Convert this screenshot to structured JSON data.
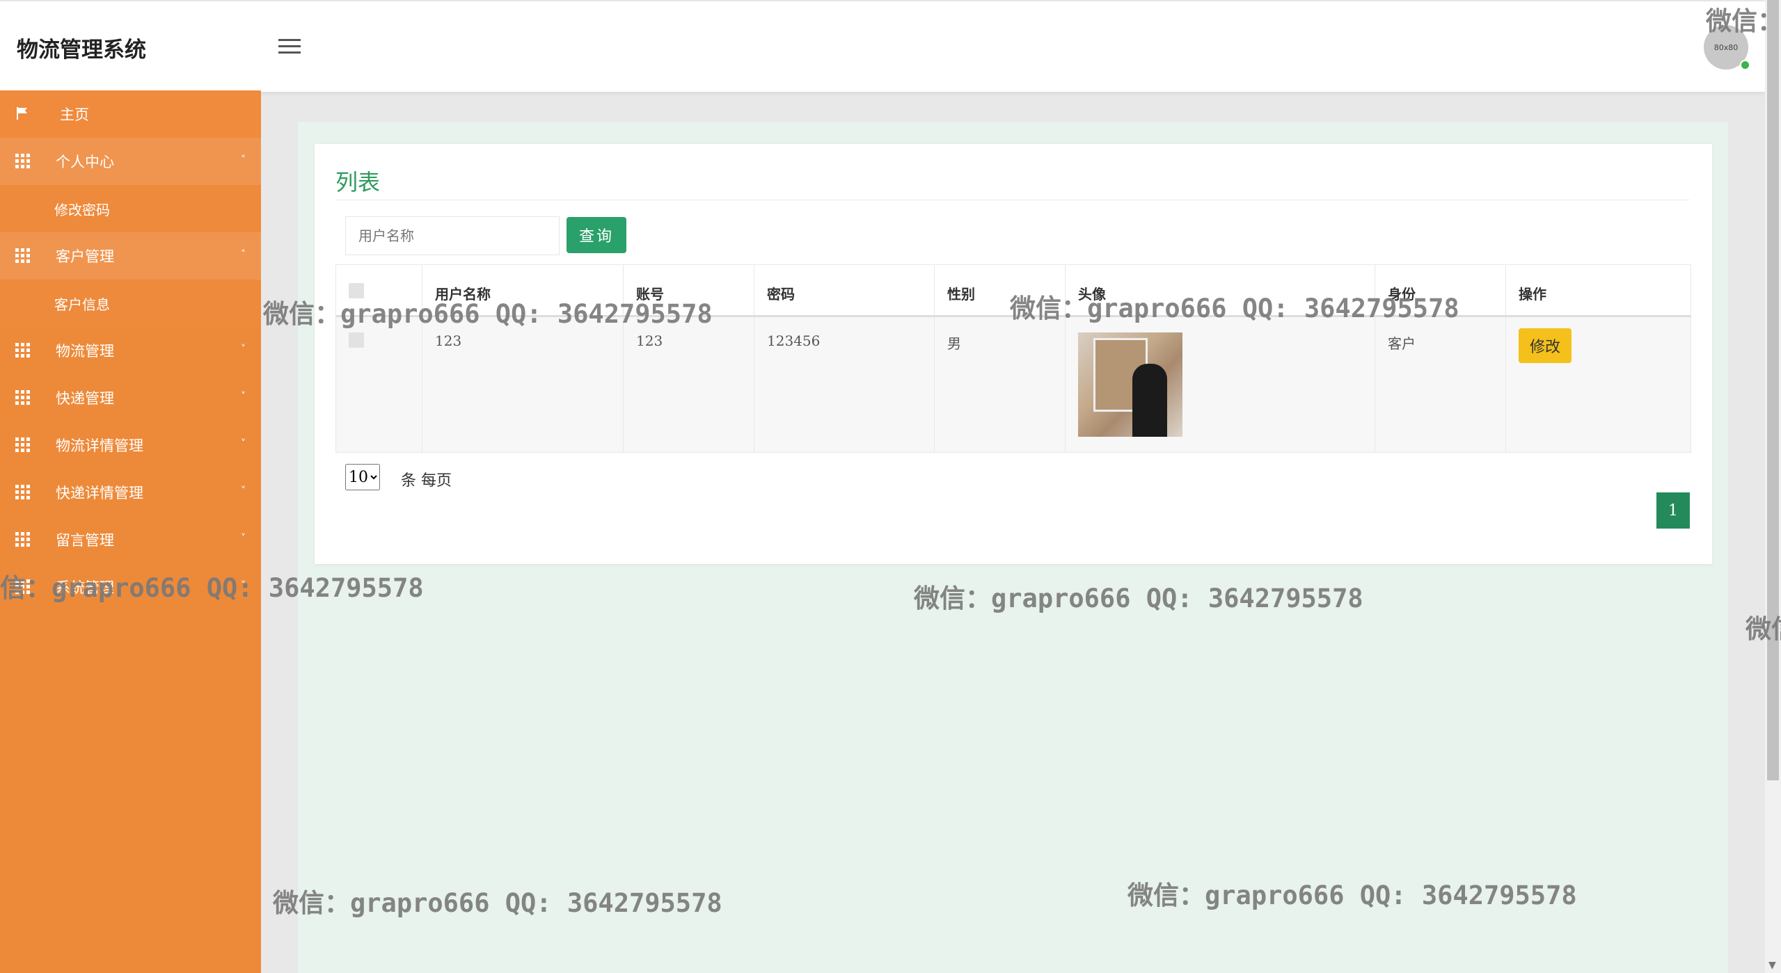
{
  "header": {
    "app_title": "物流管理系统",
    "avatar_text": "80x80"
  },
  "sidebar": {
    "home": "主页",
    "items": [
      {
        "label": "个人中心",
        "arrow": "˄",
        "sub": [
          "修改密码"
        ]
      },
      {
        "label": "客户管理",
        "arrow": "˄",
        "sub": [
          "客户信息"
        ]
      },
      {
        "label": "物流管理",
        "arrow": "˅"
      },
      {
        "label": "快递管理",
        "arrow": "˅"
      },
      {
        "label": "物流详情管理",
        "arrow": "˅"
      },
      {
        "label": "快递详情管理",
        "arrow": "˅"
      },
      {
        "label": "留言管理",
        "arrow": "˅"
      },
      {
        "label": "系统管理",
        "arrow": "˅"
      }
    ]
  },
  "main": {
    "title": "列表",
    "search_placeholder": "用户名称",
    "search_button": "查询",
    "table": {
      "headers": [
        "用户名称",
        "账号",
        "密码",
        "性别",
        "头像",
        "身份",
        "操作"
      ],
      "rows": [
        {
          "username": "123",
          "account": "123",
          "password": "123456",
          "gender": "男",
          "role": "客户",
          "action": "修改"
        }
      ]
    },
    "page_size": "10",
    "page_size_label": "条 每页",
    "current_page": "1"
  },
  "watermarks": {
    "text": "微信：grapro666 QQ: 3642795578",
    "edge_top_right": "微信：",
    "edge_left": "信：grapro666 QQ: 3642795578",
    "edge_right": "微信"
  },
  "colors": {
    "sidebar": "#ed8a3a",
    "accent_green": "#2aa06a",
    "edit_button": "#f5c01a",
    "main_background": "#e7f3ec"
  }
}
